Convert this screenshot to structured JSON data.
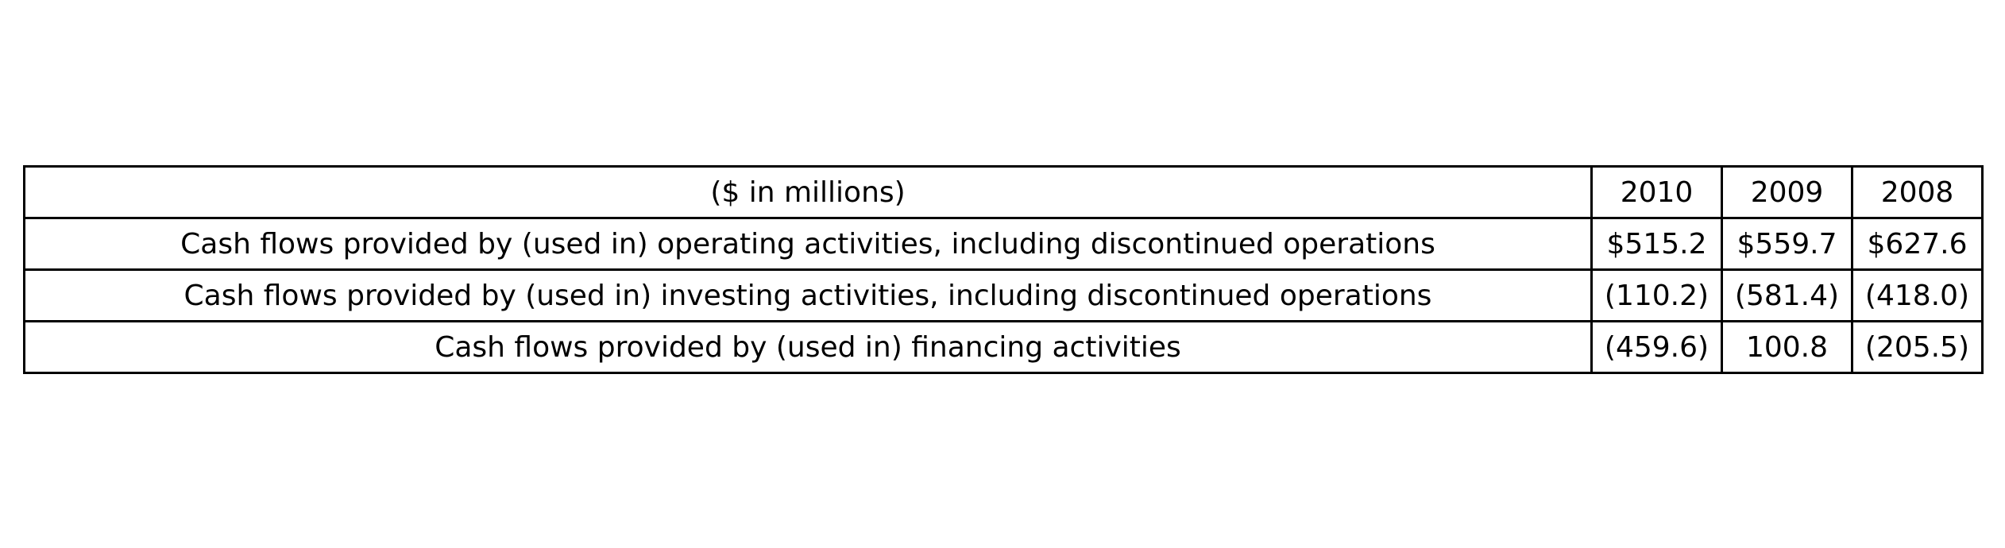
{
  "table": {
    "columns": [
      "($ in millions)",
      "2010",
      "2009",
      "2008"
    ],
    "rows": [
      {
        "label": "Cash flows provided by (used in) operating activities, including discontinued operations",
        "values": [
          "$515.2",
          "$559.7",
          "$627.6"
        ]
      },
      {
        "label": "Cash flows provided by (used in) investing activities, including discontinued operations",
        "values": [
          "(110.2)",
          "(581.4)",
          "(418.0)"
        ]
      },
      {
        "label": "Cash flows provided by (used in) financing activities",
        "values": [
          "(459.6)",
          "100.8",
          "(205.5)"
        ]
      }
    ]
  }
}
